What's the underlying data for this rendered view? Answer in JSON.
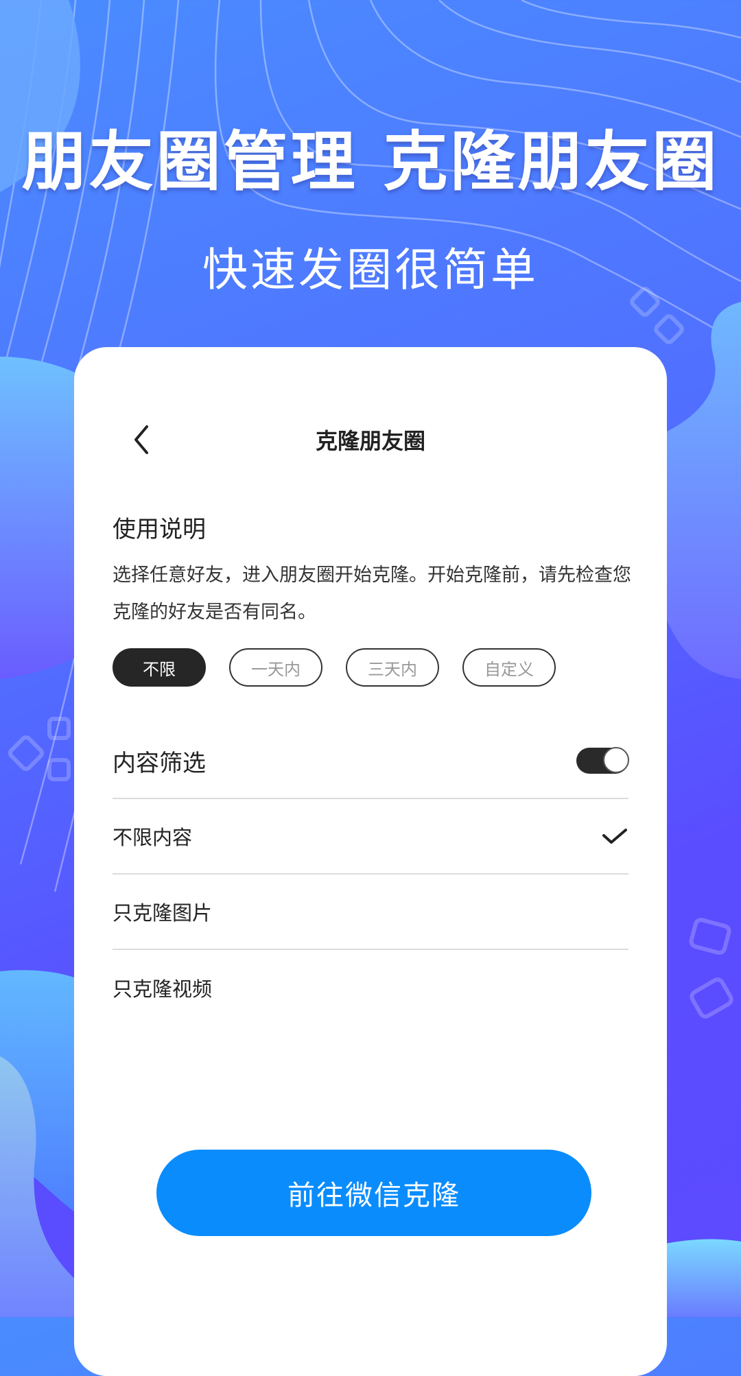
{
  "promo": {
    "headline": "朋友圈管理 克隆朋友圈",
    "subheadline": "快速发圈很简单"
  },
  "colors": {
    "background_start": "#4a8cff",
    "background_end": "#5c4bff",
    "primary_button": "#0a8cfd",
    "active_chip": "#262626",
    "toggle_on": "#2a2a2a"
  },
  "screen": {
    "title": "克隆朋友圈",
    "back_icon": "chevron-left-icon",
    "instructions": {
      "heading": "使用说明",
      "text": "选择任意好友，进入朋友圈开始克隆。开始克隆前，请先检查您克隆的好友是否有同名。"
    },
    "time_filters": [
      {
        "label": "不限",
        "selected": true
      },
      {
        "label": "一天内",
        "selected": false
      },
      {
        "label": "三天内",
        "selected": false
      },
      {
        "label": "自定义",
        "selected": false
      }
    ],
    "content_filter": {
      "label": "内容筛选",
      "enabled": true
    },
    "content_options": [
      {
        "label": "不限内容",
        "selected": true
      },
      {
        "label": "只克隆图片",
        "selected": false
      },
      {
        "label": "只克隆视频",
        "selected": false
      }
    ],
    "action_button": "前往微信克隆"
  }
}
